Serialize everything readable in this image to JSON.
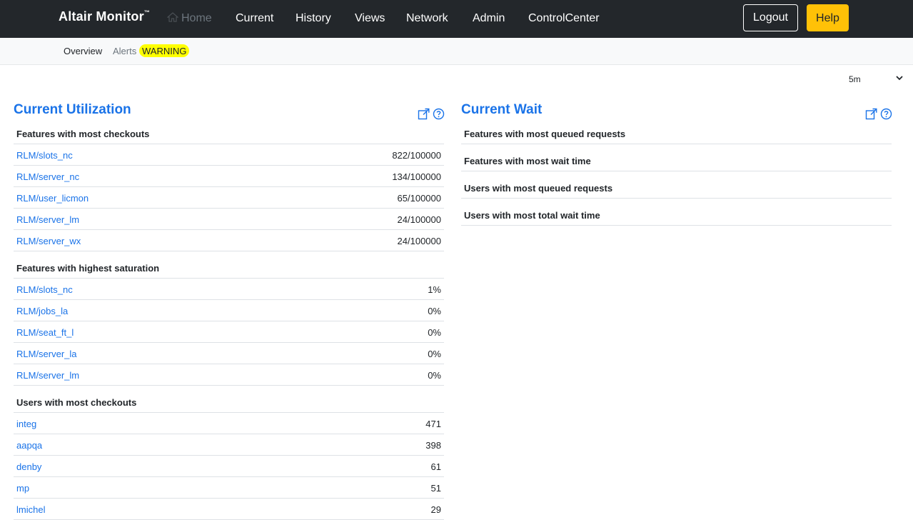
{
  "nav": {
    "brand": "Altair Monitor",
    "brand_tm": "™",
    "home": "Home",
    "items": [
      "Current",
      "History",
      "Views",
      "Network",
      "Admin",
      "ControlCenter"
    ],
    "logout": "Logout",
    "help": "Help"
  },
  "subnav": {
    "overview": "Overview",
    "alerts": "Alerts",
    "alerts_badge": "WARNING"
  },
  "range": {
    "selected": "5m"
  },
  "utilization": {
    "title": "Current Utilization",
    "sections": [
      {
        "heading": "Features with most checkouts",
        "rows": [
          {
            "name": "RLM/slots_nc",
            "value": "822/100000"
          },
          {
            "name": "RLM/server_nc",
            "value": "134/100000"
          },
          {
            "name": "RLM/user_licmon",
            "value": "65/100000"
          },
          {
            "name": "RLM/server_lm",
            "value": "24/100000"
          },
          {
            "name": "RLM/server_wx",
            "value": "24/100000"
          }
        ]
      },
      {
        "heading": "Features with highest saturation",
        "rows": [
          {
            "name": "RLM/slots_nc",
            "value": "1%"
          },
          {
            "name": "RLM/jobs_la",
            "value": "0%"
          },
          {
            "name": "RLM/seat_ft_l",
            "value": "0%"
          },
          {
            "name": "RLM/server_la",
            "value": "0%"
          },
          {
            "name": "RLM/server_lm",
            "value": "0%"
          }
        ]
      },
      {
        "heading": "Users with most checkouts",
        "rows": [
          {
            "name": "integ",
            "value": "471"
          },
          {
            "name": "aapqa",
            "value": "398"
          },
          {
            "name": "denby",
            "value": "61"
          },
          {
            "name": "mp",
            "value": "51"
          },
          {
            "name": "lmichel",
            "value": "29"
          }
        ]
      }
    ]
  },
  "wait": {
    "title": "Current Wait",
    "sections": [
      {
        "heading": "Features with most queued requests"
      },
      {
        "heading": "Features with most wait time"
      },
      {
        "heading": "Users with most queued requests"
      },
      {
        "heading": "Users with most total wait time"
      }
    ]
  },
  "icons": {
    "popout": "external-link-icon",
    "help": "question-circle-icon",
    "home": "home-icon",
    "chevron": "chevron-down-icon"
  },
  "colors": {
    "navbar_bg": "#23272b",
    "link": "#1a73e8",
    "help_button": "#ffc107",
    "warning_badge": "#ffff00"
  }
}
